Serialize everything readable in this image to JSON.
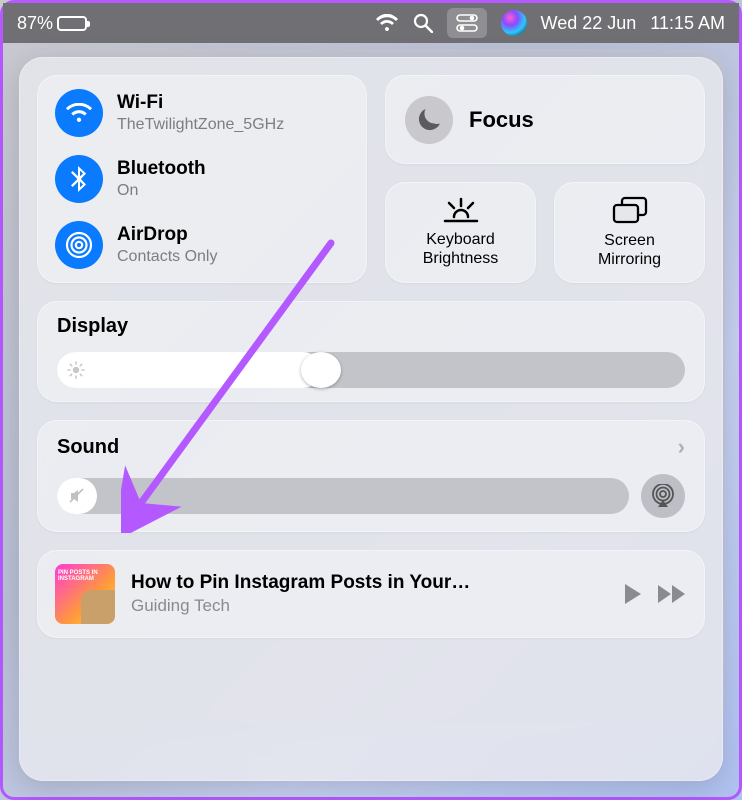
{
  "menubar": {
    "battery": "87%",
    "date": "Wed 22 Jun",
    "time": "11:15 AM"
  },
  "connectivity": {
    "wifi": {
      "title": "Wi-Fi",
      "sub": "TheTwilightZone_5GHz"
    },
    "bluetooth": {
      "title": "Bluetooth",
      "sub": "On"
    },
    "airdrop": {
      "title": "AirDrop",
      "sub": "Contacts Only"
    }
  },
  "focus": {
    "title": "Focus"
  },
  "mini": {
    "keyboard": "Keyboard\nBrightness",
    "mirror": "Screen\nMirroring"
  },
  "display": {
    "title": "Display",
    "value_pct": 40
  },
  "sound": {
    "title": "Sound"
  },
  "nowplaying": {
    "thumb_text": "PIN POSTS IN\nINSTAGRAM",
    "title": "How to Pin Instagram Posts in Your…",
    "subtitle": "Guiding Tech"
  }
}
